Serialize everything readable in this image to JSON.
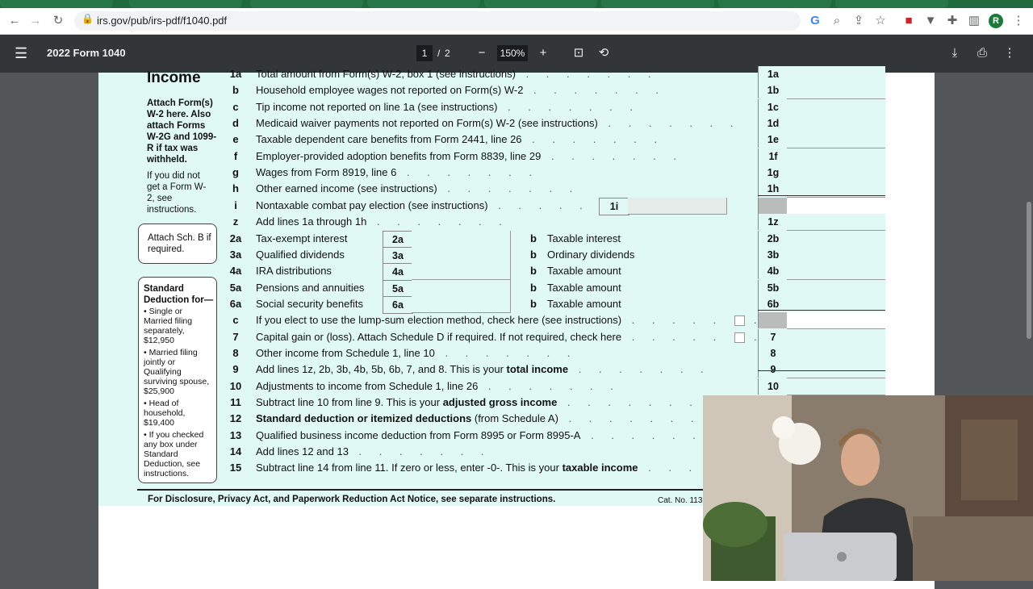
{
  "browser": {
    "url": "irs.gov/pub/irs-pdf/f1040.pdf",
    "profile_initial": "R"
  },
  "viewer": {
    "doc_title": "2022 Form 1040",
    "current_page": "1",
    "page_sep": "/",
    "total_pages": "2",
    "zoom": "150%"
  },
  "form": {
    "section": "Income",
    "side_attach_bold": "Attach Form(s) W-2 here. Also attach Forms W-2G and 1099-R if tax was withheld.",
    "side_no_w2": "If you did not get a Form W-2, see instructions.",
    "attach_sch_b": "Attach Sch. B if required.",
    "std_title": "Standard Deduction for—",
    "std_items": [
      "• Single or Married filing separately, $12,950",
      "• Married filing jointly or Qualifying surviving spouse, $25,900",
      "• Head of household, $19,400",
      "• If you checked any box under Standard Deduction, see instructions."
    ],
    "lines": [
      {
        "n": "1a",
        "t": "Total amount from Form(s) W-2, box 1 (see instructions)",
        "box": "1a"
      },
      {
        "n": "b",
        "t": "Household employee wages not reported on Form(s) W-2",
        "box": "1b"
      },
      {
        "n": "c",
        "t": "Tip income not reported on line 1a (see instructions)",
        "box": "1c"
      },
      {
        "n": "d",
        "t": "Medicaid waiver payments not reported on Form(s) W-2 (see instructions)",
        "box": "1d"
      },
      {
        "n": "e",
        "t": "Taxable dependent care benefits from Form 2441, line 26",
        "box": "1e"
      },
      {
        "n": "f",
        "t": "Employer-provided adoption benefits from Form 8839, line 29",
        "box": "1f"
      },
      {
        "n": "g",
        "t": "Wages from Form 8919, line 6",
        "box": "1g"
      },
      {
        "n": "h",
        "t": "Other earned income (see instructions)",
        "box": "1h"
      },
      {
        "n": "i",
        "t": "Nontaxable combat pay election (see instructions)",
        "box": "",
        "inner": "1i"
      },
      {
        "n": "z",
        "t": "Add lines 1a through 1h",
        "box": "1z"
      },
      {
        "n": "2a",
        "t": "Tax-exempt interest",
        "box": "2b",
        "inner": "2a",
        "b": "Taxable interest"
      },
      {
        "n": "3a",
        "t": "Qualified dividends",
        "box": "3b",
        "inner": "3a",
        "b": "Ordinary dividends"
      },
      {
        "n": "4a",
        "t": "IRA distributions",
        "box": "4b",
        "inner": "4a",
        "b": "Taxable amount"
      },
      {
        "n": "5a",
        "t": "Pensions and annuities",
        "box": "5b",
        "inner": "5a",
        "b": "Taxable amount"
      },
      {
        "n": "6a",
        "t": "Social security benefits",
        "box": "6b",
        "inner": "6a",
        "b": "Taxable amount"
      },
      {
        "n": "c",
        "t": "If you elect to use the lump-sum election method, check here (see instructions)",
        "box": ""
      },
      {
        "n": "7",
        "t": "Capital gain or (loss). Attach Schedule D if required. If not required, check here",
        "box": "7"
      },
      {
        "n": "8",
        "t": "Other income from Schedule 1, line 10",
        "box": "8"
      },
      {
        "n": "9",
        "t": "Add lines 1z, 2b, 3b, 4b, 5b, 6b, 7, and 8. This is your",
        "bold": "total income",
        "box": "9"
      },
      {
        "n": "10",
        "t": "Adjustments to income from Schedule 1, line 26",
        "box": "10"
      },
      {
        "n": "11",
        "t": "Subtract line 10 from line 9. This is your",
        "bold": "adjusted gross income",
        "box": ""
      },
      {
        "n": "12",
        "t": "",
        "bold": "Standard deduction or itemized deductions",
        "after": "(from Schedule A)",
        "box": ""
      },
      {
        "n": "13",
        "t": "Qualified business income deduction from Form 8995 or Form 8995-A",
        "box": ""
      },
      {
        "n": "14",
        "t": "Add lines 12 and 13",
        "box": ""
      },
      {
        "n": "15",
        "t": "Subtract line 14 from line 11. If zero or less, enter -0-. This is your",
        "bold": "taxable income",
        "box": ""
      }
    ],
    "b_letter": "b",
    "footer": "For Disclosure, Privacy Act, and Paperwork Reduction Act Notice, see separate instructions.",
    "cat_no": "Cat. No. 113"
  },
  "colors": {
    "form_bg": "#e0f9f4",
    "toolbar": "#323639",
    "viewer_bg": "#525659"
  }
}
